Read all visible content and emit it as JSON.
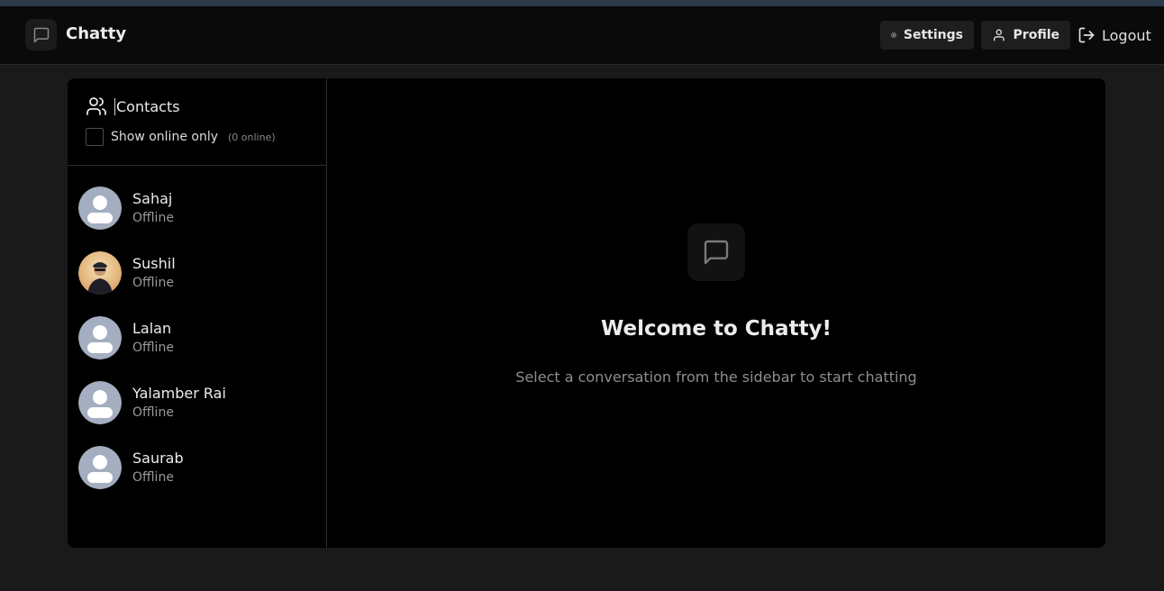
{
  "app": {
    "title": "Chatty"
  },
  "header": {
    "settings_label": "Settings",
    "profile_label": "Profile",
    "logout_label": "Logout"
  },
  "sidebar": {
    "title": "Contacts",
    "filter_label": "Show online only",
    "online_count": "(0 online)",
    "filter_checked": false,
    "contacts": [
      {
        "name": "Sahaj",
        "status": "Offline",
        "avatar": "default-avatar"
      },
      {
        "name": "Sushil",
        "status": "Offline",
        "avatar": "photo-avatar"
      },
      {
        "name": "Lalan",
        "status": "Offline",
        "avatar": "default-avatar"
      },
      {
        "name": "Yalamber Rai",
        "status": "Offline",
        "avatar": "default-avatar"
      },
      {
        "name": "Saurab",
        "status": "Offline",
        "avatar": "default-avatar"
      }
    ]
  },
  "welcome": {
    "title": "Welcome to Chatty!",
    "subtitle": "Select a conversation from the sidebar to start chatting"
  },
  "colors": {
    "background": "#1a1a1a",
    "header": "#0a0a0a",
    "panel": "#000000",
    "accent_avatar": "#a3aec0"
  },
  "icons": {
    "logo": "message-square-icon",
    "settings": "gear-icon",
    "profile": "user-icon",
    "logout": "logout-icon",
    "contacts": "users-icon"
  }
}
